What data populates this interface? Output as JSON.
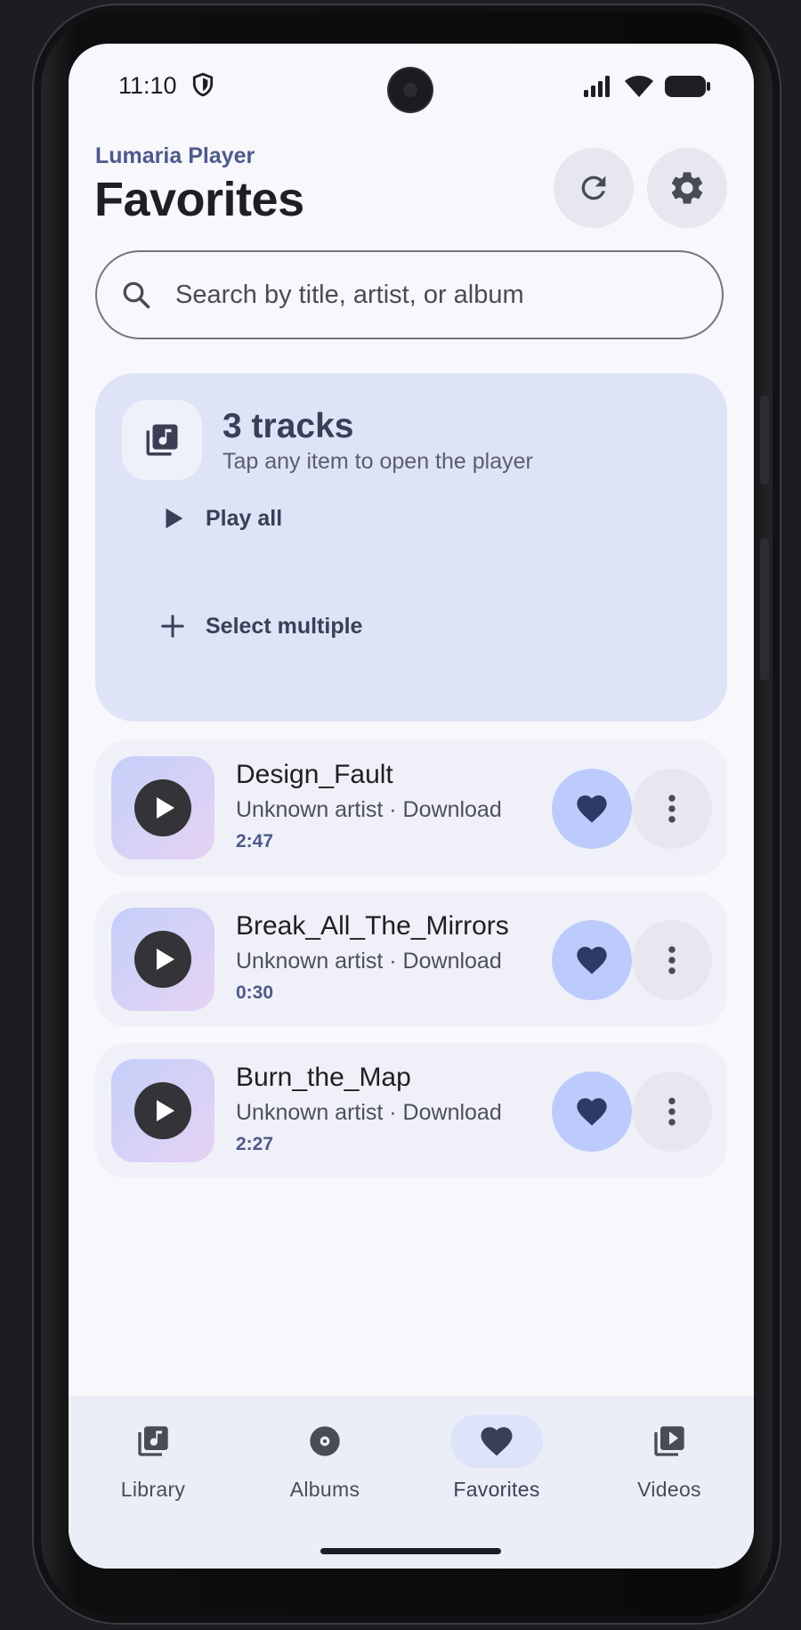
{
  "status_bar": {
    "time": "11:10"
  },
  "header": {
    "app_name": "Lumaria Player",
    "title": "Favorites"
  },
  "search": {
    "placeholder": "Search by title, artist, or album"
  },
  "summary": {
    "count": "3 tracks",
    "hint": "Tap any item to open the player",
    "play_all": "Play all",
    "select_multiple": "Select multiple"
  },
  "tracks": [
    {
      "title": "Design_Fault",
      "meta": "Unknown artist · Download",
      "duration": "2:47"
    },
    {
      "title": "Break_All_The_Mirrors",
      "meta": "Unknown artist · Download",
      "duration": "0:30"
    },
    {
      "title": "Burn_the_Map",
      "meta": "Unknown artist · Download",
      "duration": "2:27"
    }
  ],
  "nav": [
    {
      "label": "Library",
      "icon": "library-music-icon"
    },
    {
      "label": "Albums",
      "icon": "album-icon"
    },
    {
      "label": "Favorites",
      "icon": "heart-icon",
      "active": true
    },
    {
      "label": "Videos",
      "icon": "video-library-icon"
    }
  ],
  "colors": {
    "accent": "#4d5a8a",
    "favorite_button": "#bccbfb",
    "summary_card": "#dfe3f7"
  }
}
